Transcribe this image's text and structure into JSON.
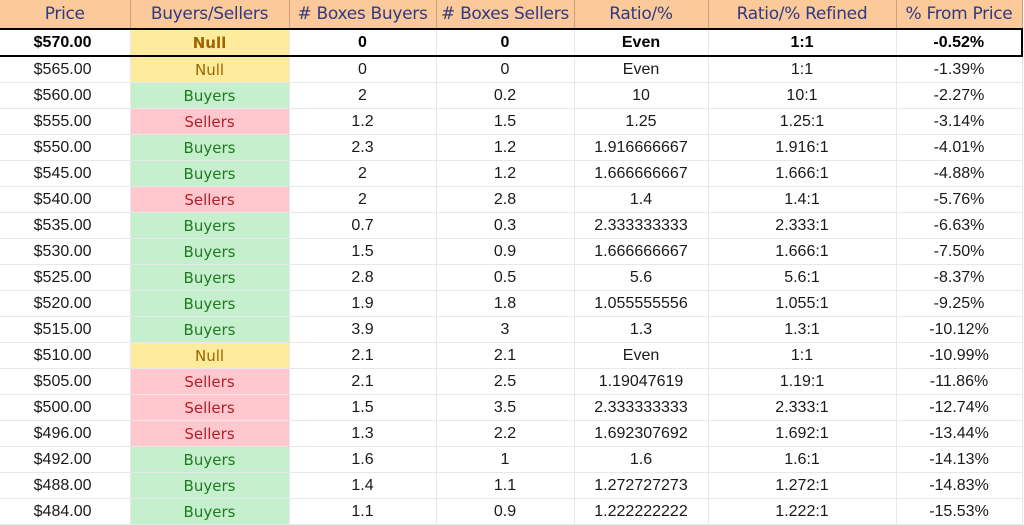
{
  "colors": {
    "header_bg": "#fcc99a",
    "header_text": "#2f3a84",
    "buyers_bg": "#c6efce",
    "buyers_text": "#1f7a21",
    "sellers_bg": "#ffc7ce",
    "sellers_text": "#b01f2a",
    "null_bg": "#ffeb9c",
    "null_text": "#9c6500"
  },
  "table": {
    "headers": [
      "Price",
      "Buyers/Sellers",
      "# Boxes Buyers",
      "# Boxes Sellers",
      "Ratio/%",
      "Ratio/% Refined",
      "% From Price"
    ],
    "rows": [
      {
        "price": "$570.00",
        "side": "Null",
        "boxes_buyers": "0",
        "boxes_sellers": "0",
        "ratio": "Even",
        "ratio_refined": "1:1",
        "pct_from_price": "-0.52%",
        "current": true
      },
      {
        "price": "$565.00",
        "side": "Null",
        "boxes_buyers": "0",
        "boxes_sellers": "0",
        "ratio": "Even",
        "ratio_refined": "1:1",
        "pct_from_price": "-1.39%"
      },
      {
        "price": "$560.00",
        "side": "Buyers",
        "boxes_buyers": "2",
        "boxes_sellers": "0.2",
        "ratio": "10",
        "ratio_refined": "10:1",
        "pct_from_price": "-2.27%"
      },
      {
        "price": "$555.00",
        "side": "Sellers",
        "boxes_buyers": "1.2",
        "boxes_sellers": "1.5",
        "ratio": "1.25",
        "ratio_refined": "1.25:1",
        "pct_from_price": "-3.14%"
      },
      {
        "price": "$550.00",
        "side": "Buyers",
        "boxes_buyers": "2.3",
        "boxes_sellers": "1.2",
        "ratio": "1.916666667",
        "ratio_refined": "1.916:1",
        "pct_from_price": "-4.01%"
      },
      {
        "price": "$545.00",
        "side": "Buyers",
        "boxes_buyers": "2",
        "boxes_sellers": "1.2",
        "ratio": "1.666666667",
        "ratio_refined": "1.666:1",
        "pct_from_price": "-4.88%"
      },
      {
        "price": "$540.00",
        "side": "Sellers",
        "boxes_buyers": "2",
        "boxes_sellers": "2.8",
        "ratio": "1.4",
        "ratio_refined": "1.4:1",
        "pct_from_price": "-5.76%"
      },
      {
        "price": "$535.00",
        "side": "Buyers",
        "boxes_buyers": "0.7",
        "boxes_sellers": "0.3",
        "ratio": "2.333333333",
        "ratio_refined": "2.333:1",
        "pct_from_price": "-6.63%"
      },
      {
        "price": "$530.00",
        "side": "Buyers",
        "boxes_buyers": "1.5",
        "boxes_sellers": "0.9",
        "ratio": "1.666666667",
        "ratio_refined": "1.666:1",
        "pct_from_price": "-7.50%"
      },
      {
        "price": "$525.00",
        "side": "Buyers",
        "boxes_buyers": "2.8",
        "boxes_sellers": "0.5",
        "ratio": "5.6",
        "ratio_refined": "5.6:1",
        "pct_from_price": "-8.37%"
      },
      {
        "price": "$520.00",
        "side": "Buyers",
        "boxes_buyers": "1.9",
        "boxes_sellers": "1.8",
        "ratio": "1.055555556",
        "ratio_refined": "1.055:1",
        "pct_from_price": "-9.25%"
      },
      {
        "price": "$515.00",
        "side": "Buyers",
        "boxes_buyers": "3.9",
        "boxes_sellers": "3",
        "ratio": "1.3",
        "ratio_refined": "1.3:1",
        "pct_from_price": "-10.12%"
      },
      {
        "price": "$510.00",
        "side": "Null",
        "boxes_buyers": "2.1",
        "boxes_sellers": "2.1",
        "ratio": "Even",
        "ratio_refined": "1:1",
        "pct_from_price": "-10.99%"
      },
      {
        "price": "$505.00",
        "side": "Sellers",
        "boxes_buyers": "2.1",
        "boxes_sellers": "2.5",
        "ratio": "1.19047619",
        "ratio_refined": "1.19:1",
        "pct_from_price": "-11.86%"
      },
      {
        "price": "$500.00",
        "side": "Sellers",
        "boxes_buyers": "1.5",
        "boxes_sellers": "3.5",
        "ratio": "2.333333333",
        "ratio_refined": "2.333:1",
        "pct_from_price": "-12.74%"
      },
      {
        "price": "$496.00",
        "side": "Sellers",
        "boxes_buyers": "1.3",
        "boxes_sellers": "2.2",
        "ratio": "1.692307692",
        "ratio_refined": "1.692:1",
        "pct_from_price": "-13.44%"
      },
      {
        "price": "$492.00",
        "side": "Buyers",
        "boxes_buyers": "1.6",
        "boxes_sellers": "1",
        "ratio": "1.6",
        "ratio_refined": "1.6:1",
        "pct_from_price": "-14.13%"
      },
      {
        "price": "$488.00",
        "side": "Buyers",
        "boxes_buyers": "1.4",
        "boxes_sellers": "1.1",
        "ratio": "1.272727273",
        "ratio_refined": "1.272:1",
        "pct_from_price": "-14.83%"
      },
      {
        "price": "$484.00",
        "side": "Buyers",
        "boxes_buyers": "1.1",
        "boxes_sellers": "0.9",
        "ratio": "1.222222222",
        "ratio_refined": "1.222:1",
        "pct_from_price": "-15.53%"
      }
    ]
  }
}
